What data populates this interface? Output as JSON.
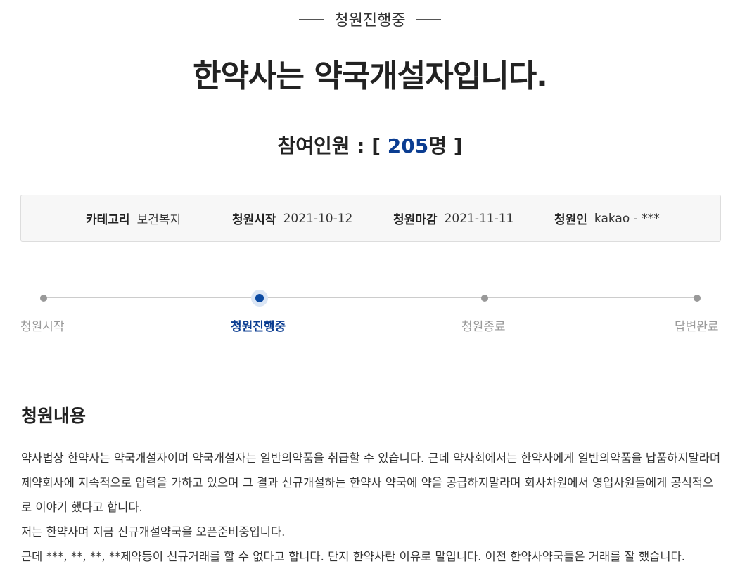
{
  "header": {
    "status": "청원진행중",
    "title": "한약사는 약국개설자입니다.",
    "participants_label": "참여인원 : [ ",
    "participants_count": "205",
    "participants_suffix": "명 ]"
  },
  "info": {
    "category_label": "카테고리",
    "category_value": "보건복지",
    "start_label": "청원시작",
    "start_value": "2021-10-12",
    "end_label": "청원마감",
    "end_value": "2021-11-11",
    "author_label": "청원인",
    "author_value": "kakao - ***"
  },
  "progress": {
    "steps": [
      {
        "label": "청원시작"
      },
      {
        "label": "청원진행중"
      },
      {
        "label": "청원종료"
      },
      {
        "label": "답변완료"
      }
    ],
    "current_step": 2
  },
  "content": {
    "section_title": "청원내용",
    "paragraphs": [
      "약사법상 한약사는 약국개설자이며 약국개설자는 일반의약품을 취급할 수 있습니다. 근데 약사회에서는 한약사에게 일반의약품을 납품하지말라며 제약회사에 지속적으로 압력을 가하고 있으며 그 결과 신규개설하는 한약사 약국에 약을 공급하지말라며 회사차원에서 영업사원들에게 공식적으로 이야기 했다고 합니다.",
      "저는 한약사며 지금 신규개설약국을 오픈준비중입니다.",
      "근데 ***, **, **, **제약등이 신규거래를 할 수 없다고 합니다. 단지 한약사란 이유로 말입니다. 이전 한약사약국들은 거래를 잘 했습니다."
    ]
  }
}
